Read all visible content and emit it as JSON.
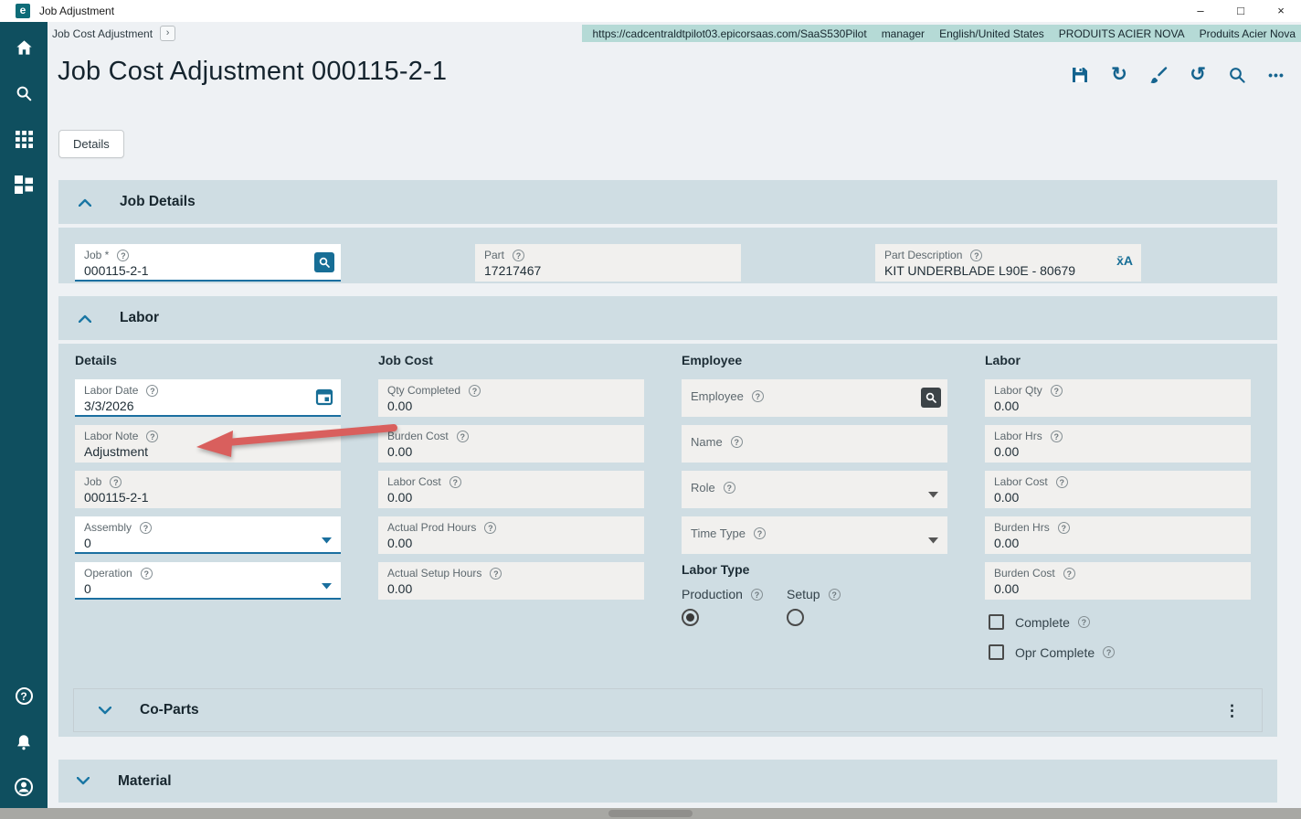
{
  "window": {
    "title": "Job Adjustment",
    "controls": {
      "minimize": "–",
      "maximize": "□",
      "close": "×"
    }
  },
  "header": {
    "breadcrumb": "Job Cost Adjustment",
    "env": {
      "url": "https://cadcentraldtpilot03.epicorsaas.com/SaaS530Pilot",
      "user": "manager",
      "locale": "English/United States",
      "company": "PRODUITS ACIER NOVA",
      "site": "Produits Acier Nova"
    }
  },
  "page": {
    "title": "Job Cost Adjustment 000115-2-1"
  },
  "tabs": {
    "details": "Details"
  },
  "toolbar": {
    "icons": [
      "save",
      "refresh",
      "clear",
      "undo",
      "search",
      "overflow"
    ]
  },
  "sidebar": {
    "icons": [
      "home",
      "search",
      "app-menu",
      "dashboard",
      "help",
      "notifications",
      "account"
    ]
  },
  "glyphs": {
    "logo": "e",
    "breadcrumb_chevron": "›",
    "refresh": "↻",
    "undo": "↺",
    "overflow": "•••",
    "kebab": "⋮",
    "translate": "x̄A",
    "help": "?"
  },
  "job_details": {
    "title": "Job Details",
    "job": {
      "label": "Job *",
      "value": "000115-2-1"
    },
    "part": {
      "label": "Part",
      "value": "17217467"
    },
    "part_description": {
      "label": "Part Description",
      "value": "KIT UNDERBLADE L90E - 80679"
    }
  },
  "labor": {
    "title": "Labor",
    "details": {
      "title": "Details",
      "labor_date": {
        "label": "Labor Date",
        "value": "3/3/2026"
      },
      "labor_note": {
        "label": "Labor Note",
        "value": "Adjustment"
      },
      "job": {
        "label": "Job",
        "value": "000115-2-1"
      },
      "assembly": {
        "label": "Assembly",
        "value": "0"
      },
      "operation": {
        "label": "Operation",
        "value": "0"
      }
    },
    "job_cost": {
      "title": "Job Cost",
      "qty_completed": {
        "label": "Qty Completed",
        "value": "0.00"
      },
      "burden_cost": {
        "label": "Burden Cost",
        "value": "0.00"
      },
      "labor_cost": {
        "label": "Labor Cost",
        "value": "0.00"
      },
      "actual_prod_hours": {
        "label": "Actual Prod Hours",
        "value": "0.00"
      },
      "actual_setup_hours": {
        "label": "Actual Setup Hours",
        "value": "0.00"
      }
    },
    "employee": {
      "title": "Employee",
      "employee": {
        "label": "Employee",
        "value": ""
      },
      "name": {
        "label": "Name",
        "value": ""
      },
      "role": {
        "label": "Role",
        "value": ""
      },
      "time_type": {
        "label": "Time Type",
        "value": ""
      }
    },
    "labor_group": {
      "title": "Labor",
      "labor_qty": {
        "label": "Labor Qty",
        "value": "0.00"
      },
      "labor_hrs": {
        "label": "Labor Hrs",
        "value": "0.00"
      },
      "labor_cost": {
        "label": "Labor Cost",
        "value": "0.00"
      },
      "burden_hrs": {
        "label": "Burden Hrs",
        "value": "0.00"
      },
      "burden_cost": {
        "label": "Burden Cost",
        "value": "0.00"
      },
      "complete": {
        "label": "Complete",
        "checked": false
      },
      "opr_complete": {
        "label": "Opr Complete",
        "checked": false
      }
    },
    "labor_type": {
      "title": "Labor Type",
      "production": {
        "label": "Production",
        "selected": true
      },
      "setup": {
        "label": "Setup",
        "selected": false
      }
    }
  },
  "co_parts": {
    "title": "Co-Parts"
  },
  "material": {
    "title": "Material"
  },
  "colors": {
    "accent": "#1a6f9e",
    "sidebar": "#0f4f5f",
    "section_bg": "#cfdde3",
    "readonly_bg": "#f1f0ee",
    "env_bar": "#b5dad6",
    "annotation_arrow": "#d95f5d"
  }
}
